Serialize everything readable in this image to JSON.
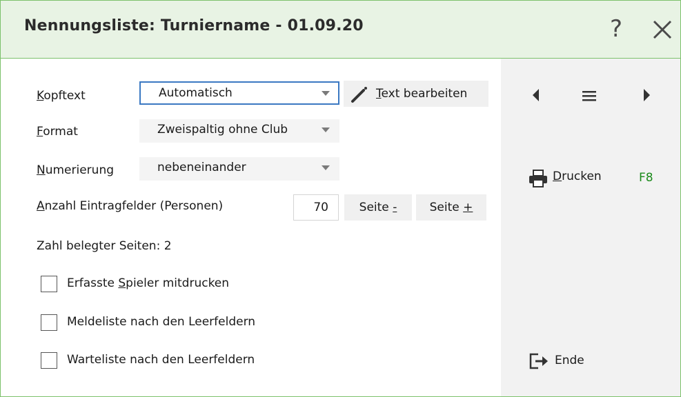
{
  "window": {
    "title": "Nennungsliste: Turniername - 01.09.20",
    "help_label": "?"
  },
  "form": {
    "kopftext": {
      "label_key": "K",
      "label_rest": "opftext",
      "value": "Automatisch"
    },
    "edit_button": {
      "key": "T",
      "rest": "ext bearbeiten"
    },
    "format": {
      "label_key": "F",
      "label_rest": "ormat",
      "value": "Zweispaltig ohne Club"
    },
    "numerierung": {
      "label_key": "N",
      "label_rest": "umerierung",
      "value": "nebeneinander"
    },
    "anzahl": {
      "label_key": "A",
      "label_rest": "nzahl Eintragfelder (Personen)",
      "value": "70"
    },
    "seite_minus": {
      "pre": "Seite ",
      "key": "-"
    },
    "seite_plus": {
      "pre": "Seite ",
      "key": "+"
    },
    "belegte_seiten": "Zahl belegter Seiten: 2",
    "checkboxes": [
      {
        "pre": "Erfasste ",
        "key": "S",
        "post": "pieler mitdrucken",
        "checked": false
      },
      {
        "pre": "Meldeliste nach den Leerfeldern",
        "key": "",
        "post": "",
        "checked": false
      },
      {
        "pre": "Warteliste nach den Leerfeldern",
        "key": "",
        "post": "",
        "checked": false
      }
    ]
  },
  "side": {
    "drucken": {
      "key": "D",
      "rest": "rucken",
      "shortcut": "F8"
    },
    "ende": "Ende"
  }
}
